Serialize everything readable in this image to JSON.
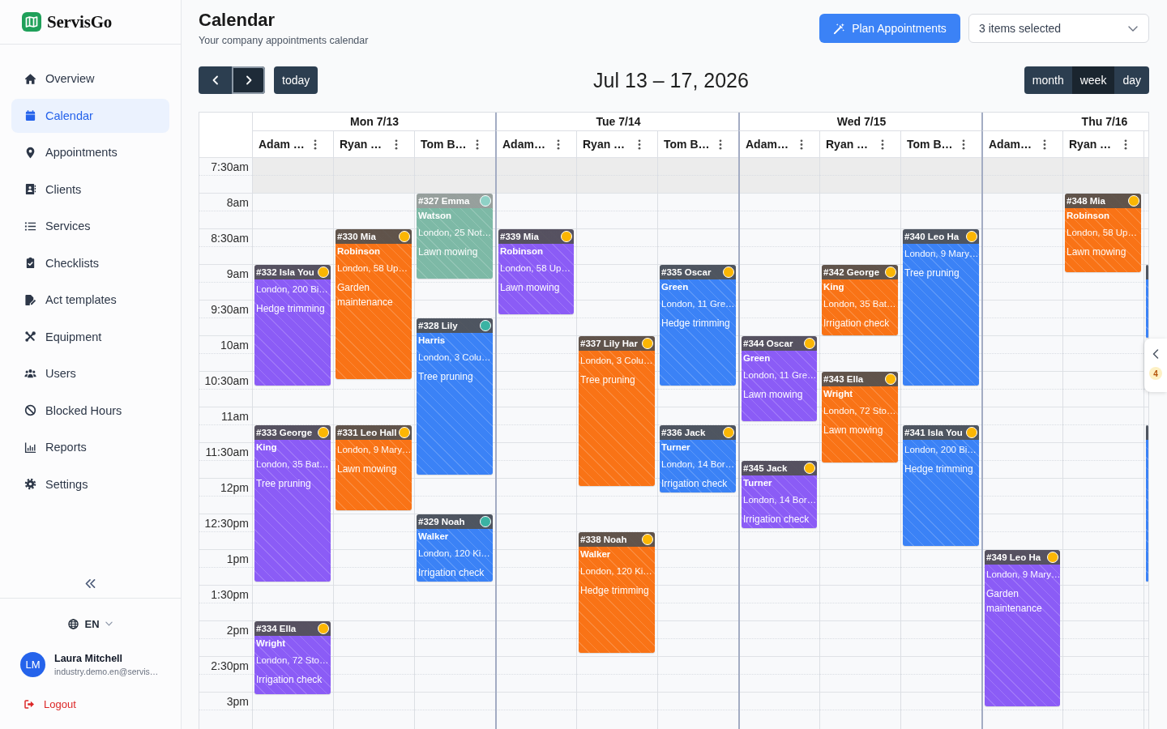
{
  "sidebar": {
    "logo": {
      "text": "ServisGo"
    },
    "nav": [
      {
        "label": "Overview",
        "selected": false
      },
      {
        "label": "Calendar",
        "selected": true
      },
      {
        "label": "Appointments",
        "selected": false
      },
      {
        "label": "Clients",
        "selected": false
      },
      {
        "label": "Services",
        "selected": false
      },
      {
        "label": "Checklists",
        "selected": false
      },
      {
        "label": "Act templates",
        "selected": false
      },
      {
        "label": "Equipment",
        "selected": false
      },
      {
        "label": "Users",
        "selected": false
      },
      {
        "label": "Blocked Hours",
        "selected": false
      },
      {
        "label": "Reports",
        "selected": false
      },
      {
        "label": "Settings",
        "selected": false
      }
    ],
    "language": "EN",
    "user": {
      "initials": "LM",
      "name": "Laura Mitchell",
      "email": "industry.demo.en@servis…"
    },
    "logout": "Logout"
  },
  "header": {
    "title": "Calendar",
    "subtitle": "Your company appointments calendar",
    "plan_button": "Plan Appointments",
    "filter": {
      "value": "3 items selected"
    }
  },
  "toolbar": {
    "nav_buttons": [
      {
        "kind": "prev",
        "focused": false
      },
      {
        "kind": "next",
        "focused": true
      }
    ],
    "today": "today",
    "range_title": "Jul 13 – 17, 2026",
    "views": [
      {
        "label": "month",
        "selected": false
      },
      {
        "label": "week",
        "selected": true
      },
      {
        "label": "day",
        "selected": false
      }
    ]
  },
  "calendar": {
    "time_slots": [
      {
        "label": "7:30am",
        "off_hours": true
      },
      {
        "label": "8am",
        "off_hours": false
      },
      {
        "label": "8:30am",
        "off_hours": false
      },
      {
        "label": "9am",
        "off_hours": false
      },
      {
        "label": "9:30am",
        "off_hours": false
      },
      {
        "label": "10am",
        "off_hours": false
      },
      {
        "label": "10:30am",
        "off_hours": false
      },
      {
        "label": "11am",
        "off_hours": false
      },
      {
        "label": "11:30am",
        "off_hours": false
      },
      {
        "label": "12pm",
        "off_hours": false
      },
      {
        "label": "12:30pm",
        "off_hours": false
      },
      {
        "label": "1pm",
        "off_hours": false
      },
      {
        "label": "1:30pm",
        "off_hours": false
      },
      {
        "label": "2pm",
        "off_hours": false
      },
      {
        "label": "2:30pm",
        "off_hours": false
      },
      {
        "label": "3pm",
        "off_hours": false
      }
    ],
    "days": [
      {
        "label": "Mon 7/13",
        "columns": [
          {
            "name": "Adam …",
            "appointments": [
              {
                "title": "#332 Isla You",
                "address": "London, 200 Bi…",
                "service": "Hedge trimming",
                "color": "#8b5cf6",
                "status": {
                  "color": "#fbb604"
                },
                "dimmed": false
              },
              {
                "title": "#333 George King",
                "address": "London, 35 Bat…",
                "service": "Tree pruning",
                "color": "#8b5cf6",
                "status": {
                  "color": "#fbb604"
                },
                "dimmed": false
              },
              {
                "title": "#334 Ella Wright",
                "address": "London, 72 Sto…",
                "service": "Irrigation check",
                "color": "#8b5cf6",
                "status": {
                  "color": "#fbb604"
                },
                "dimmed": false
              }
            ]
          },
          {
            "name": "Ryan …",
            "appointments": [
              {
                "title": "#330 Mia Robinson",
                "address": "London, 58 Up…",
                "service": "Garden maintenance",
                "color": "#f97316",
                "status": {
                  "color": "#fbb604"
                },
                "dimmed": false
              },
              {
                "title": "#331 Leo Hall",
                "address": "London, 9 Mary…",
                "service": "Lawn mowing",
                "color": "#f97316",
                "status": {
                  "color": "#fbb604"
                },
                "dimmed": false
              }
            ]
          },
          {
            "name": "Tom B…",
            "appointments": [
              {
                "title": "#327 Emma Watson",
                "address": "London, 25 Not…",
                "service": "Lawn mowing",
                "color": "#7db9a6",
                "status": {
                  "color": "#8fd1c6"
                },
                "dimmed": true
              },
              {
                "title": "#328 Lily Harris",
                "address": "London, 3 Colu…",
                "service": "Tree pruning",
                "color": "#3b82f6",
                "status": {
                  "color": "#3bb3a3"
                },
                "dimmed": false
              },
              {
                "title": "#329 Noah Walker",
                "address": "London, 120 Ki…",
                "service": "Irrigation check",
                "color": "#3b82f6",
                "status": {
                  "color": "#3bb3a3"
                },
                "dimmed": false
              }
            ]
          }
        ]
      },
      {
        "label": "Tue 7/14",
        "columns": [
          {
            "name": "Adam…",
            "appointments": [
              {
                "title": "#339 Mia Robinson",
                "address": "London, 58 Up…",
                "service": "Lawn mowing",
                "color": "#8b5cf6",
                "status": {
                  "color": "#fbb604"
                },
                "dimmed": false
              }
            ]
          },
          {
            "name": "Ryan …",
            "appointments": [
              {
                "title": "#337 Lily Har",
                "address": "London, 3 Colu…",
                "service": "Tree pruning",
                "color": "#f97316",
                "status": {
                  "color": "#fbb604"
                },
                "dimmed": false
              },
              {
                "title": "#338 Noah Walker",
                "address": "London, 120 Ki…",
                "service": "Hedge trimming",
                "color": "#f97316",
                "status": {
                  "color": "#fbb604"
                },
                "dimmed": false
              }
            ]
          },
          {
            "name": "Tom B…",
            "appointments": [
              {
                "title": "#335 Oscar Green",
                "address": "London, 11 Gre…",
                "service": "Hedge trimming",
                "color": "#3b82f6",
                "status": {
                  "color": "#fbb604"
                },
                "dimmed": false
              },
              {
                "title": "#336 Jack Turner",
                "address": "London, 14 Bor…",
                "service": "Irrigation check",
                "color": "#3b82f6",
                "status": {
                  "color": "#fbb604"
                },
                "dimmed": false
              }
            ]
          }
        ]
      },
      {
        "label": "Wed 7/15",
        "columns": [
          {
            "name": "Adam…",
            "appointments": [
              {
                "title": "#344 Oscar Green",
                "address": "London, 11 Gre…",
                "service": "Lawn mowing",
                "color": "#8b5cf6",
                "status": {
                  "color": "#fbb604"
                },
                "dimmed": false
              },
              {
                "title": "#345 Jack Turner",
                "address": "London, 14 Bor…",
                "service": "Irrigation check",
                "color": "#8b5cf6",
                "status": {
                  "color": "#fbb604"
                },
                "dimmed": false
              }
            ]
          },
          {
            "name": "Ryan …",
            "appointments": [
              {
                "title": "#342 George King",
                "address": "London, 35 Bat…",
                "service": "Irrigation check",
                "color": "#f97316",
                "status": {
                  "color": "#fbb604"
                },
                "dimmed": false
              },
              {
                "title": "#343 Ella Wright",
                "address": "London, 72 Sto…",
                "service": "Lawn mowing",
                "color": "#f97316",
                "status": {
                  "color": "#fbb604"
                },
                "dimmed": false
              }
            ]
          },
          {
            "name": "Tom B…",
            "appointments": [
              {
                "title": "#340 Leo Ha",
                "address": "London, 9 Mary…",
                "service": "Tree pruning",
                "color": "#3b82f6",
                "status": {
                  "color": "#fbb604"
                },
                "dimmed": false
              },
              {
                "title": "#341 Isla You",
                "address": "London, 200 Bi…",
                "service": "Hedge trimming",
                "color": "#3b82f6",
                "status": {
                  "color": "#fbb604"
                },
                "dimmed": false
              }
            ]
          }
        ]
      },
      {
        "label": "Thu 7/16",
        "columns": [
          {
            "name": "Adam…",
            "appointments": [
              {
                "title": "#349 Leo Ha",
                "address": "London, 9 Mary…",
                "service": "Garden maintenance",
                "color": "#8b5cf6",
                "status": {
                  "color": "#fbb604"
                },
                "dimmed": false
              }
            ]
          },
          {
            "name": "Ryan …",
            "appointments": [
              {
                "title": "#348 Mia Robinson",
                "address": "London, 58 Up…",
                "service": "Lawn mowing",
                "color": "#f97316",
                "status": {
                  "color": "#fbb604"
                },
                "dimmed": false
              }
            ]
          },
          {
            "appointments": [
              {
                "color": "#3b82f6",
                "dimmed": false
              },
              {
                "color": "#3b82f6",
                "dimmed": false
              }
            ]
          }
        ]
      }
    ]
  },
  "side_panel_toggle": {
    "badge": "4"
  }
}
